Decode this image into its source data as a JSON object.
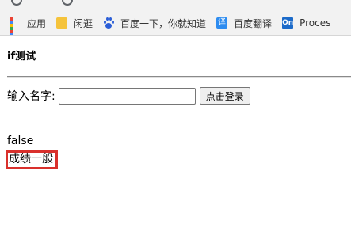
{
  "bookmarks": [
    {
      "icon": "apps-icon",
      "label": "应用"
    },
    {
      "icon": "folder-icon",
      "label": "闲逛"
    },
    {
      "icon": "baidu-paw-icon",
      "label": "百度一下，你就知道"
    },
    {
      "icon": "baidu-translate-icon",
      "icon_glyph": "译",
      "label": "百度翻译"
    },
    {
      "icon": "processon-icon",
      "icon_glyph": "On",
      "label": "Proces"
    }
  ],
  "page": {
    "title": "if测试",
    "form": {
      "label": "输入名字:",
      "input_value": "",
      "input_placeholder": "",
      "submit_label": "点击登录"
    },
    "result_bool": "false",
    "result_grade": "成绩一般",
    "highlight_color": "#d9302c"
  }
}
